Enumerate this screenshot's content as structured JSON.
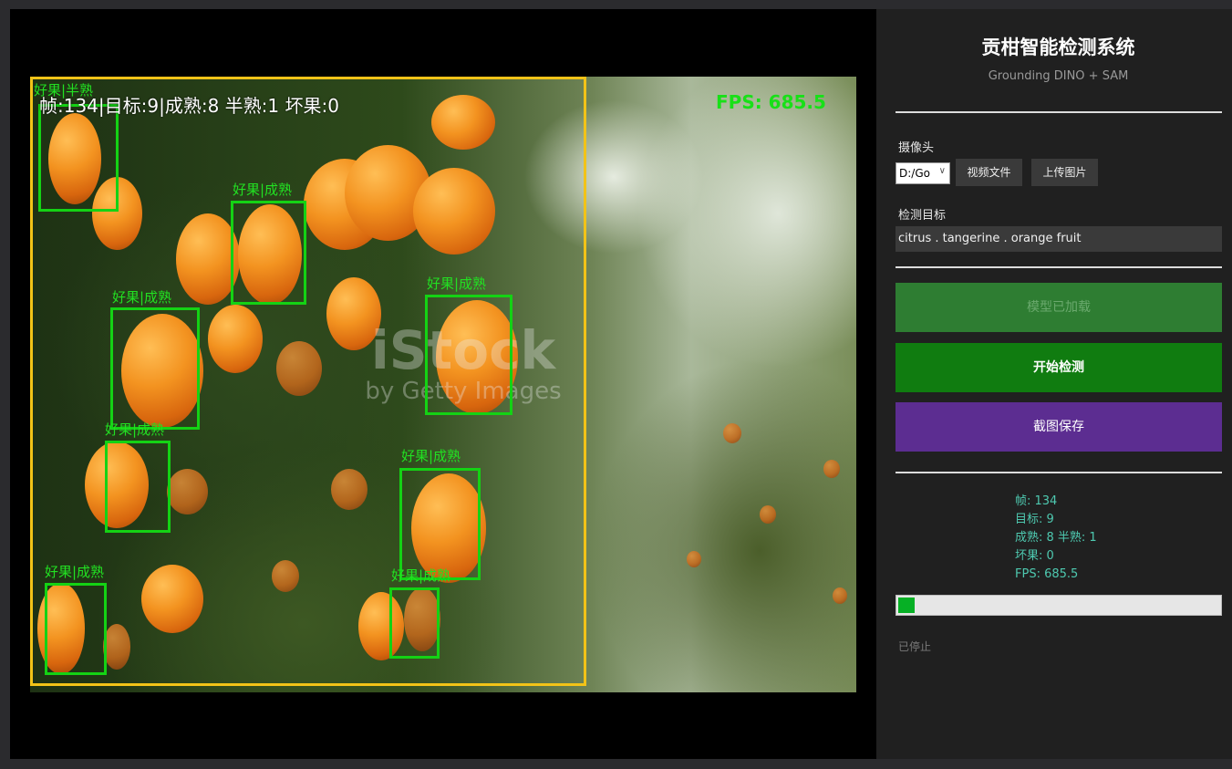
{
  "app": {
    "title": "贡柑智能检测系统",
    "subtitle": "Grounding DINO + SAM"
  },
  "video": {
    "overlay_stats": "帧:134|目标:9|成熟:8 半熟:1 坏果:0",
    "overlay_fps": "FPS: 685.5",
    "watermark_main": "iStock",
    "watermark_sub": "by Getty Images",
    "detections": [
      {
        "label": "好果|半熟"
      },
      {
        "label": "好果|成熟"
      },
      {
        "label": "好果|成熟"
      },
      {
        "label": "好果|成熟"
      },
      {
        "label": "好果|成熟"
      },
      {
        "label": "好果|成熟"
      },
      {
        "label": "好果|成熟"
      },
      {
        "label": "好果|成熟"
      },
      {
        "label": "好果|成熟"
      }
    ]
  },
  "controls": {
    "camera_label": "摄像头",
    "camera_value": "D:/Go",
    "video_file_button": "视频文件",
    "upload_image_button": "上传图片",
    "target_label": "检测目标",
    "target_value": "citrus . tangerine . orange fruit",
    "model_loaded_button": "模型已加载",
    "start_button": "开始检测",
    "screenshot_button": "截图保存"
  },
  "stats": {
    "frame": "帧: 134",
    "targets": "目标: 9",
    "ripeness": "成熟: 8  半熟: 1",
    "bad": "坏果: 0",
    "fps": "FPS: 685.5"
  },
  "progress": {
    "value": 0.05
  },
  "status": {
    "text": "已停止"
  },
  "colors": {
    "roi_box": "#f2c318",
    "detection_box": "#14d214",
    "start_button": "#107c10",
    "loaded_button": "#2e7d32",
    "screenshot_button": "#5c2d91",
    "stats_text": "#4ec9b0",
    "progress_fill": "#06b025"
  }
}
